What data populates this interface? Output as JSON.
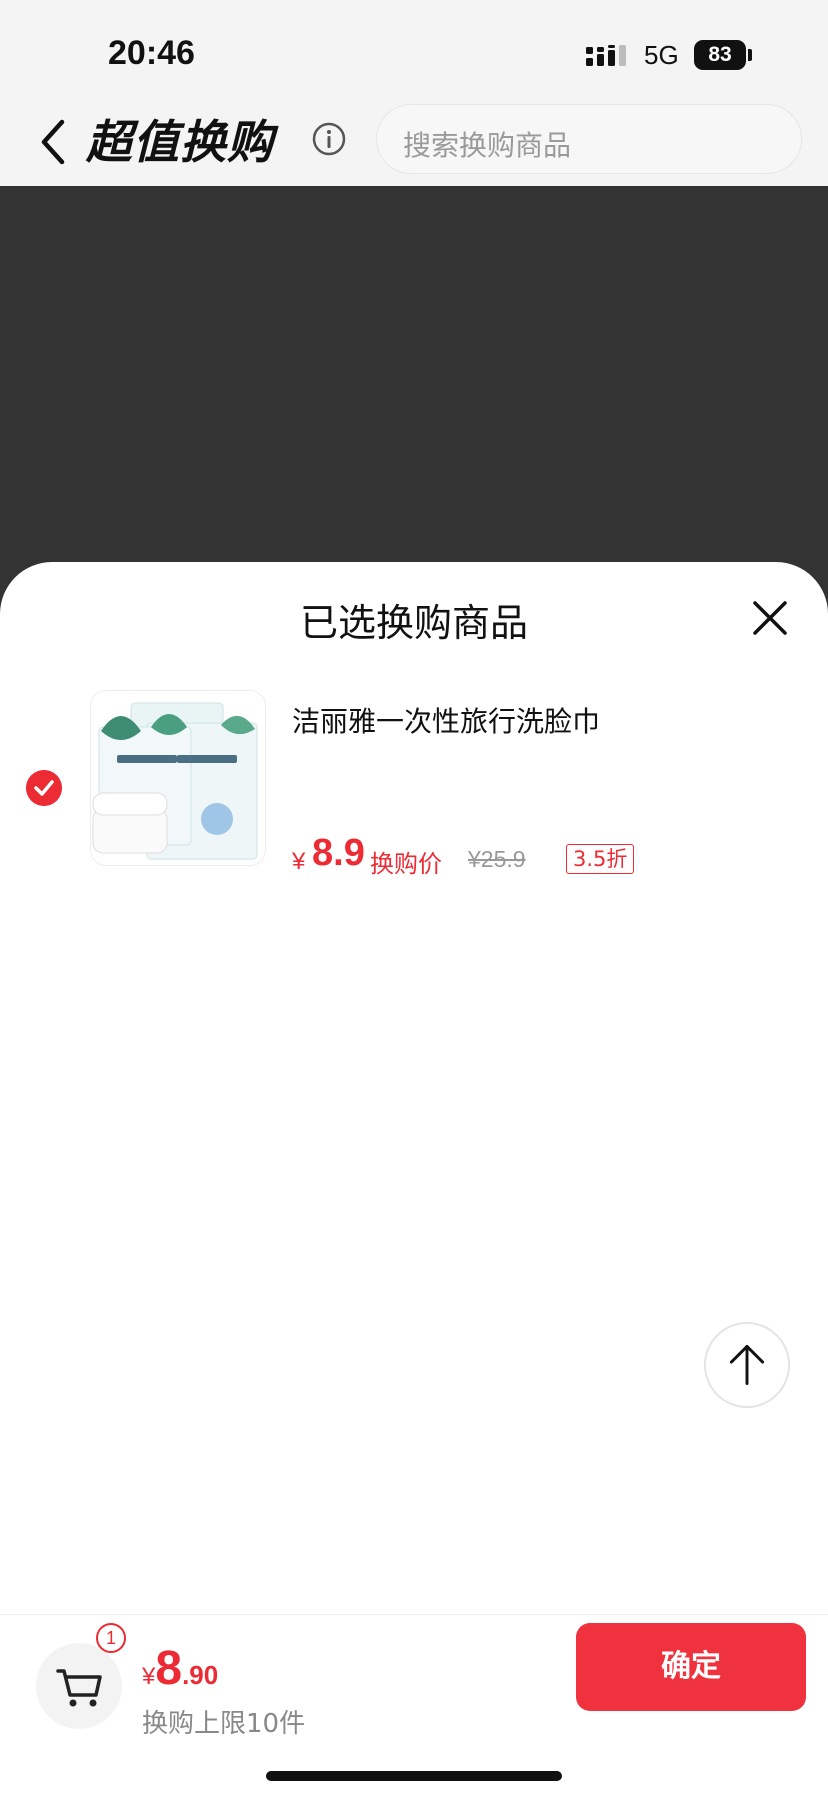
{
  "status_bar": {
    "time": "20:46",
    "network": "5G",
    "battery": "83"
  },
  "nav": {
    "title": "超值换购",
    "search_placeholder": "搜索换购商品"
  },
  "sheet": {
    "title": "已选换购商品",
    "items": [
      {
        "name": "洁丽雅一次性旅行洗脸巾",
        "currency": "¥",
        "price": "8.9",
        "price_label": "换购价",
        "original_price": "¥25.9",
        "discount": "3.5折",
        "selected": true
      }
    ]
  },
  "footer": {
    "cart_count": "1",
    "total_currency": "¥",
    "total_int": "8",
    "total_dec": ".90",
    "limit_text": "换购上限10件",
    "confirm_label": "确定"
  },
  "colors": {
    "accent": "#ec2b35",
    "overlay": "#333333"
  },
  "icons": [
    "back-arrow-icon",
    "info-icon",
    "close-icon",
    "check-icon",
    "arrow-up-icon",
    "cart-icon"
  ]
}
